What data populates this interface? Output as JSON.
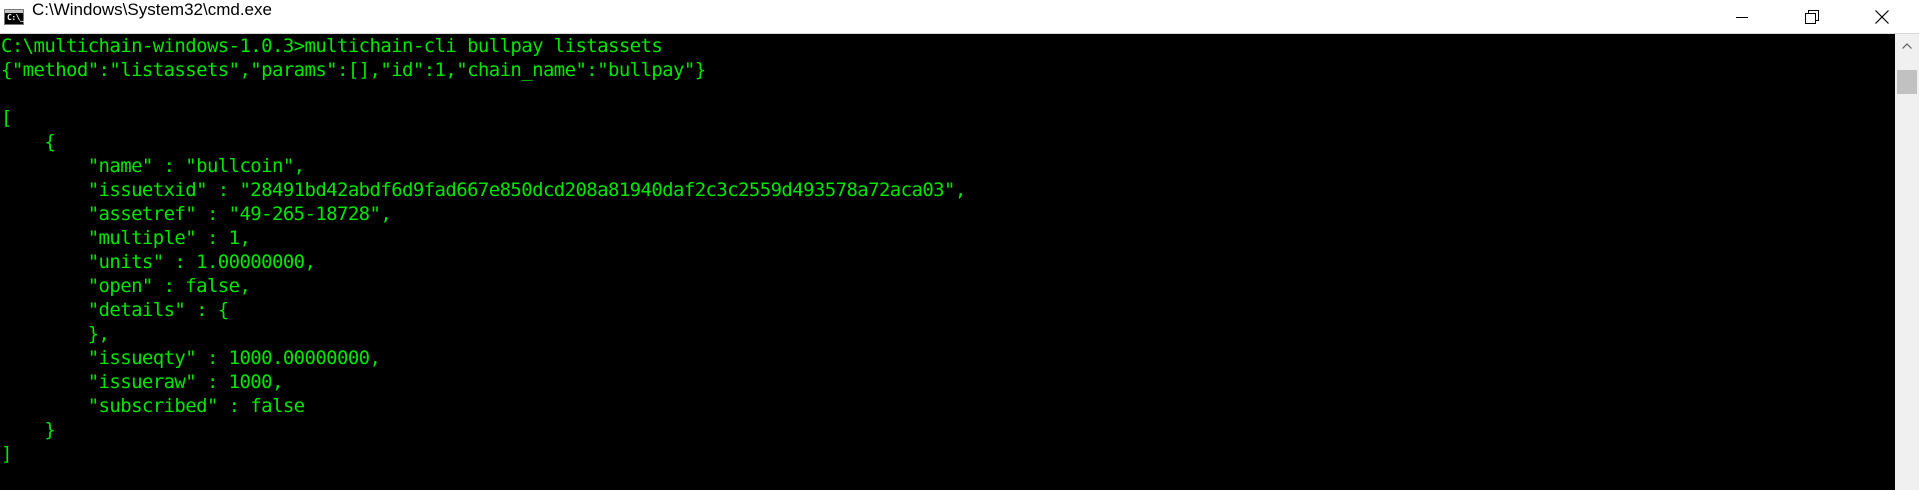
{
  "window": {
    "title": "C:\\Windows\\System32\\cmd.exe",
    "icon_label": "C:\\_"
  },
  "icons": {
    "app": "cmd-icon",
    "minimize": "minimize-icon",
    "maximize": "maximize-icon",
    "close": "close-icon",
    "scroll_up": "chevron-up-icon"
  },
  "colors": {
    "console_background": "#000000",
    "console_text": "#00e600",
    "titlebar_background": "#ffffff"
  },
  "console": {
    "lines": [
      "C:\\multichain-windows-1.0.3>multichain-cli bullpay listassets",
      "{\"method\":\"listassets\",\"params\":[],\"id\":1,\"chain_name\":\"bullpay\"}",
      "",
      "[",
      "    {",
      "        \"name\" : \"bullcoin\",",
      "        \"issuetxid\" : \"28491bd42abdf6d9fad667e850dcd208a81940daf2c3c2559d493578a72aca03\",",
      "        \"assetref\" : \"49-265-18728\",",
      "        \"multiple\" : 1,",
      "        \"units\" : 1.00000000,",
      "        \"open\" : false,",
      "        \"details\" : {",
      "        },",
      "        \"issueqty\" : 1000.00000000,",
      "        \"issueraw\" : 1000,",
      "        \"subscribed\" : false",
      "    }",
      "]"
    ]
  }
}
